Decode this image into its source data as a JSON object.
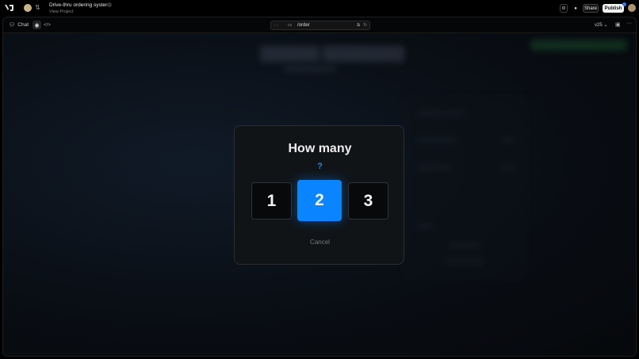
{
  "topbar": {
    "project_name": "Drive-thru ordering system",
    "view_project": "View Project",
    "share_label": "Share",
    "publish_label": "Publish"
  },
  "toolbar": {
    "chat_label": "Chat",
    "url_path": "/order",
    "version": "v25"
  },
  "modal": {
    "title": "How many",
    "question_mark": "?",
    "options": [
      "1",
      "2",
      "3"
    ],
    "selected": "2",
    "cancel_label": "Cancel"
  },
  "colors": {
    "accent": "#0a84ff",
    "question": "#1f8ce6",
    "publish_bg": "#f2f2f2"
  },
  "icons": [
    "v0-logo-icon",
    "chevron-updown-icon",
    "lock-icon",
    "gear-icon",
    "github-icon",
    "chat-icon",
    "eye-icon",
    "code-icon",
    "back-icon",
    "forward-icon",
    "monitor-icon",
    "open-external-icon",
    "refresh-icon",
    "chevron-down-icon",
    "layout-icon",
    "more-icon"
  ]
}
